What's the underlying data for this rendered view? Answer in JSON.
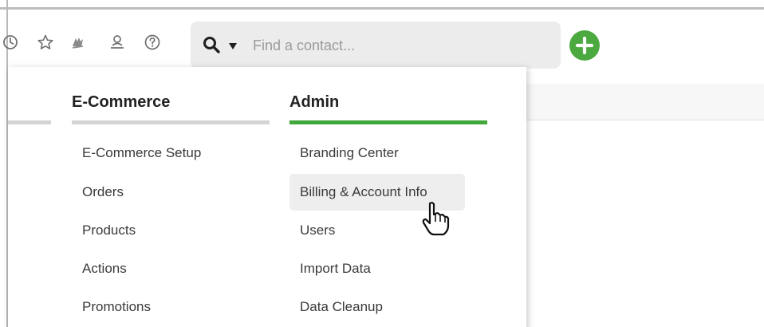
{
  "toolbar": {
    "icons": [
      "clock-icon",
      "star-icon",
      "leaf-icon",
      "user-icon",
      "help-icon"
    ],
    "search": {
      "placeholder": "Find a contact..."
    },
    "add_icon": "plus-icon"
  },
  "menu": {
    "columns": [
      {
        "heading": "E-Commerce",
        "items": [
          "E-Commerce Setup",
          "Orders",
          "Products",
          "Actions",
          "Promotions"
        ]
      },
      {
        "heading": "Admin",
        "items": [
          "Branding Center",
          "Billing & Account Info",
          "Users",
          "Import Data",
          "Data Cleanup"
        ],
        "hovered_index": 1
      }
    ]
  },
  "colors": {
    "active_rule": "#41a83c",
    "inactive_rule": "#d4d4d4",
    "add_button": "#4ca93f",
    "search_bg": "#ececec"
  }
}
